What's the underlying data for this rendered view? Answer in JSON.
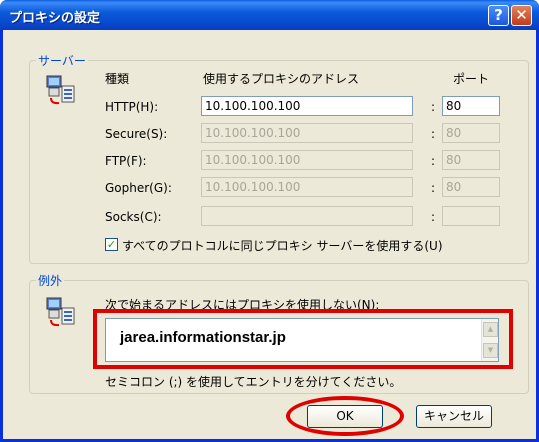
{
  "window": {
    "title": "プロキシの設定",
    "help_label": "?",
    "close_label": "✕"
  },
  "servers": {
    "legend": "サーバー",
    "type_header": "種類",
    "address_header": "使用するプロキシのアドレス",
    "port_header": "ポート",
    "rows": [
      {
        "label": "HTTP(H):",
        "address": "10.100.100.100",
        "port": "80",
        "disabled": false
      },
      {
        "label": "Secure(S):",
        "address": "10.100.100.100",
        "port": "80",
        "disabled": true
      },
      {
        "label": "FTP(F):",
        "address": "10.100.100.100",
        "port": "80",
        "disabled": true
      },
      {
        "label": "Gopher(G):",
        "address": "10.100.100.100",
        "port": "80",
        "disabled": true
      },
      {
        "label": "Socks(C):",
        "address": "",
        "port": "",
        "disabled": true
      }
    ],
    "same_proxy_label": "すべてのプロトコルに同じプロキシ サーバーを使用する(U)",
    "same_proxy_checked": true,
    "check_mark": "✓"
  },
  "exceptions": {
    "legend": "例外",
    "prompt": "次で始まるアドレスにはプロキシを使用しない(N):",
    "value": "jarea.informationstar.jp",
    "note": "セミコロン (;) を使用してエントリを分けてください。"
  },
  "buttons": {
    "ok": "OK",
    "cancel": "キャンセル"
  },
  "icons": {
    "computer": "network-computers-icon",
    "up": "scroll-up-arrow-icon",
    "down": "scroll-down-arrow-icon"
  },
  "colors": {
    "title_bar": "#0a5fe0",
    "highlight": "#e00000",
    "legend_text": "#0046d5"
  }
}
